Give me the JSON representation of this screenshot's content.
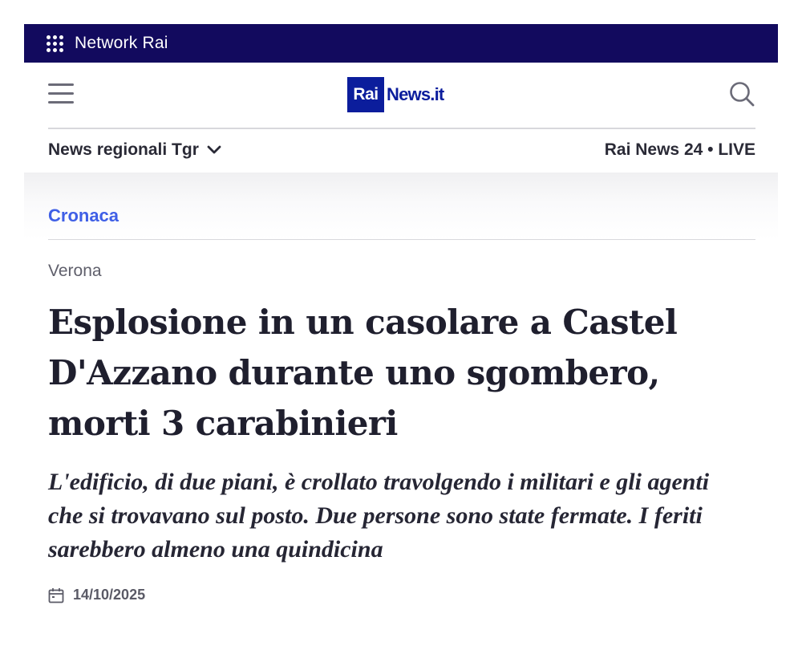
{
  "topbar": {
    "label": "Network Rai",
    "icon": "apps-grid-icon"
  },
  "header": {
    "menu_icon": "hamburger-menu-icon",
    "logo": {
      "part1": "Rai",
      "part2": "News.it"
    },
    "search_icon": "search-icon"
  },
  "subnav": {
    "regional": "News regionali Tgr",
    "regional_icon": "chevron-down-icon",
    "live": "Rai News 24 • LIVE"
  },
  "article": {
    "category": "Cronaca",
    "location": "Verona",
    "headline": "Esplosione in un casolare a Castel D'Azzano durante uno sgombero, morti 3 carabinieri",
    "subheadline": "L'edificio, di due piani, è crollato travolgendo i militari e gli agenti che si trovavano sul posto. Due persone sono state fermate. I feriti sarebbero almeno una quindicina",
    "date": "14/10/2025",
    "date_icon": "calendar-icon"
  },
  "colors": {
    "topbar_bg": "#120a5e",
    "brand_blue": "#0b1d9c",
    "category_blue": "#3f5fe6",
    "headline_text": "#1f1f2e"
  }
}
